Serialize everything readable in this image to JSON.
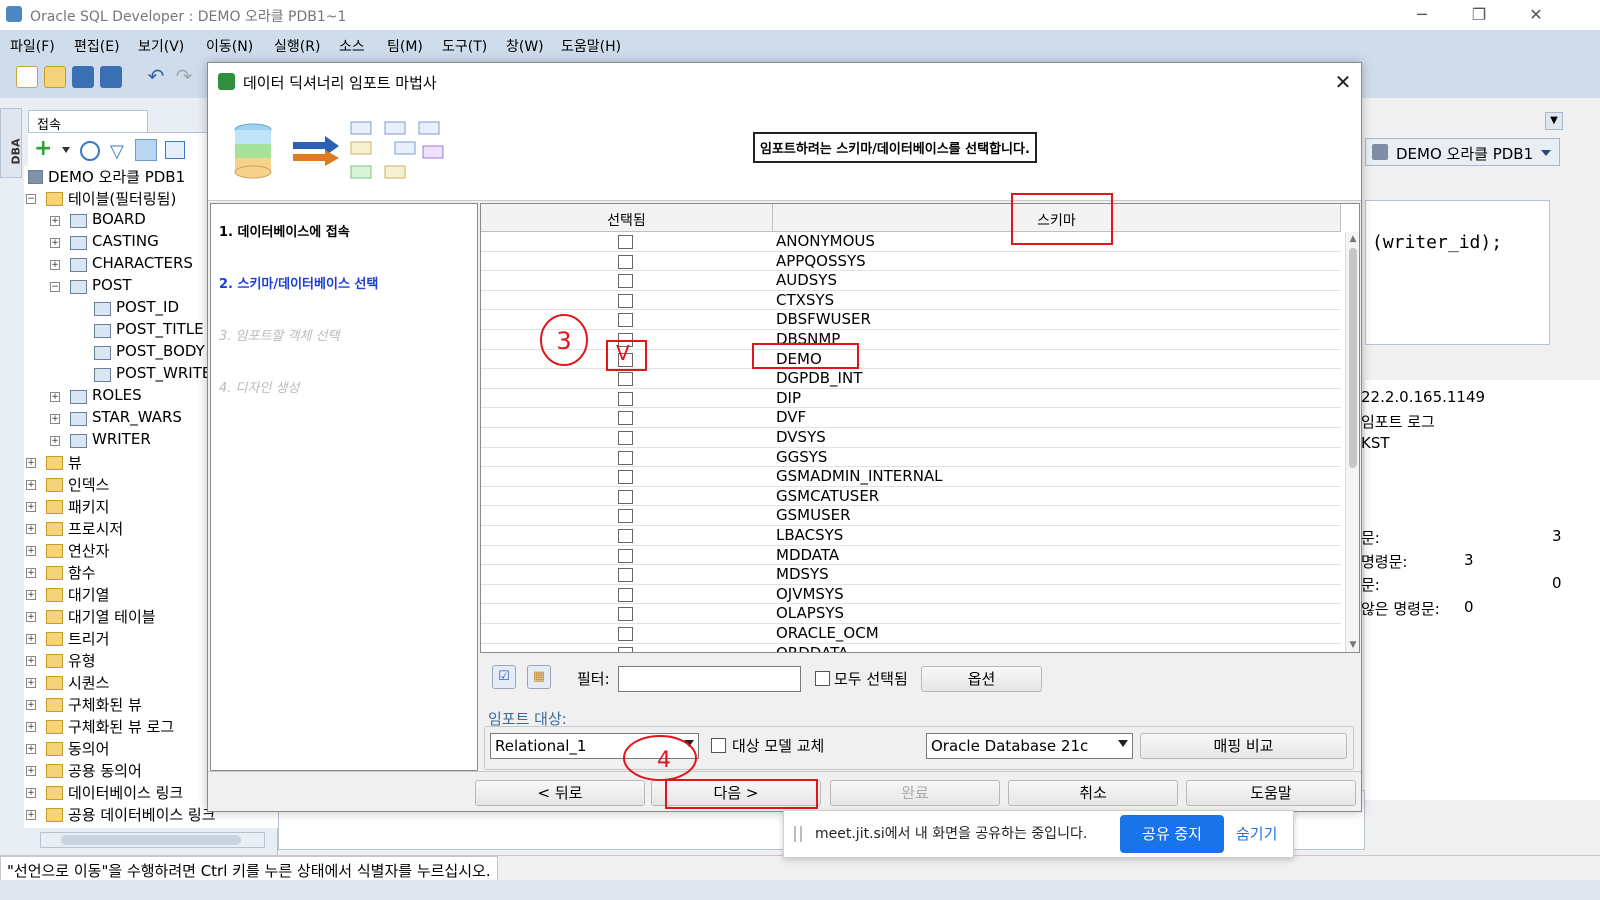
{
  "window": {
    "title": "Oracle SQL Developer : DEMO 오라클 PDB1~1",
    "controls": [
      "─",
      "❐",
      "✕"
    ]
  },
  "menubar": [
    "파일(F)",
    "편집(E)",
    "보기(V)",
    "이동(N)",
    "실행(R)",
    "소스",
    "팀(M)",
    "도구(T)",
    "창(W)",
    "도움말(H)"
  ],
  "left_panel": {
    "dba_tab": "DBA",
    "connections_tab": "접속",
    "tree": [
      {
        "label": "DEMO 오라클 PDB1",
        "level": 0,
        "exp": "",
        "icon": "db"
      },
      {
        "label": "테이블(필터링됨)",
        "level": 1,
        "exp": "−",
        "icon": "folder"
      },
      {
        "label": "BOARD",
        "level": 2,
        "exp": "+",
        "icon": "table"
      },
      {
        "label": "CASTING",
        "level": 2,
        "exp": "+",
        "icon": "table"
      },
      {
        "label": "CHARACTERS",
        "level": 2,
        "exp": "+",
        "icon": "table"
      },
      {
        "label": "POST",
        "level": 2,
        "exp": "−",
        "icon": "table"
      },
      {
        "label": "POST_ID",
        "level": 3,
        "exp": "",
        "icon": "column"
      },
      {
        "label": "POST_TITLE",
        "level": 3,
        "exp": "",
        "icon": "column"
      },
      {
        "label": "POST_BODY",
        "level": 3,
        "exp": "",
        "icon": "column"
      },
      {
        "label": "POST_WRITE",
        "level": 3,
        "exp": "",
        "icon": "column"
      },
      {
        "label": "ROLES",
        "level": 2,
        "exp": "+",
        "icon": "table"
      },
      {
        "label": "STAR_WARS",
        "level": 2,
        "exp": "+",
        "icon": "table"
      },
      {
        "label": "WRITER",
        "level": 2,
        "exp": "+",
        "icon": "table"
      },
      {
        "label": "뷰",
        "level": 1,
        "exp": "+",
        "icon": "folder"
      },
      {
        "label": "인덱스",
        "level": 1,
        "exp": "+",
        "icon": "folder"
      },
      {
        "label": "패키지",
        "level": 1,
        "exp": "+",
        "icon": "folder"
      },
      {
        "label": "프로시저",
        "level": 1,
        "exp": "+",
        "icon": "folder"
      },
      {
        "label": "연산자",
        "level": 1,
        "exp": "+",
        "icon": "folder"
      },
      {
        "label": "함수",
        "level": 1,
        "exp": "+",
        "icon": "folder"
      },
      {
        "label": "대기열",
        "level": 1,
        "exp": "+",
        "icon": "folder"
      },
      {
        "label": "대기열 테이블",
        "level": 1,
        "exp": "+",
        "icon": "folder"
      },
      {
        "label": "트리거",
        "level": 1,
        "exp": "+",
        "icon": "folder"
      },
      {
        "label": "유형",
        "level": 1,
        "exp": "+",
        "icon": "folder"
      },
      {
        "label": "시퀀스",
        "level": 1,
        "exp": "+",
        "icon": "folder"
      },
      {
        "label": "구체화된 뷰",
        "level": 1,
        "exp": "+",
        "icon": "folder"
      },
      {
        "label": "구체화된 뷰 로그",
        "level": 1,
        "exp": "+",
        "icon": "folder"
      },
      {
        "label": "동의어",
        "level": 1,
        "exp": "+",
        "icon": "folder"
      },
      {
        "label": "공용 동의어",
        "level": 1,
        "exp": "+",
        "icon": "folder"
      },
      {
        "label": "데이터베이스 링크",
        "level": 1,
        "exp": "+",
        "icon": "folder"
      },
      {
        "label": "공용 데이터베이스 링크",
        "level": 1,
        "exp": "+",
        "icon": "folder"
      }
    ]
  },
  "right_panel": {
    "connection_combo": "DEMO 오라클 PDB1",
    "editor_text": "(writer_id);",
    "log": [
      {
        "label": "22.2.0.165.1149",
        "value": ""
      },
      {
        "label": "임포트 로그",
        "value": ""
      },
      {
        "label": "KST",
        "value": ""
      },
      {
        "label": "문:",
        "value": "3"
      },
      {
        "label": "명령문:",
        "value": "3"
      },
      {
        "label": "문:",
        "value": "0"
      },
      {
        "label": "않은 명령문:",
        "value": "0"
      }
    ]
  },
  "dialog": {
    "title": "데이터 딕셔너리 임포트 마법사",
    "close": "✕",
    "header_message": "임포트하려는 스키마/데이터베이스를 선택합니다.",
    "steps": [
      {
        "label": "1. 데이터베이스에 접속",
        "state": "done"
      },
      {
        "label": "2. 스키마/데이터베이스 선택",
        "state": "active"
      },
      {
        "label": "3. 임포트할 객체 선택",
        "state": "disabled"
      },
      {
        "label": "4. 디자인 생성",
        "state": "disabled"
      }
    ],
    "grid": {
      "col_selected": "선택됨",
      "col_schema": "스키마",
      "rows": [
        {
          "name": "ANONYMOUS",
          "checked": false
        },
        {
          "name": "APPQOSSYS",
          "checked": false
        },
        {
          "name": "AUDSYS",
          "checked": false
        },
        {
          "name": "CTXSYS",
          "checked": false
        },
        {
          "name": "DBSFWUSER",
          "checked": false
        },
        {
          "name": "DBSNMP",
          "checked": false
        },
        {
          "name": "DEMO",
          "checked": true
        },
        {
          "name": "DGPDB_INT",
          "checked": false
        },
        {
          "name": "DIP",
          "checked": false
        },
        {
          "name": "DVF",
          "checked": false
        },
        {
          "name": "DVSYS",
          "checked": false
        },
        {
          "name": "GGSYS",
          "checked": false
        },
        {
          "name": "GSMADMIN_INTERNAL",
          "checked": false
        },
        {
          "name": "GSMCATUSER",
          "checked": false
        },
        {
          "name": "GSMUSER",
          "checked": false
        },
        {
          "name": "LBACSYS",
          "checked": false
        },
        {
          "name": "MDDATA",
          "checked": false
        },
        {
          "name": "MDSYS",
          "checked": false
        },
        {
          "name": "OJVMSYS",
          "checked": false
        },
        {
          "name": "OLAPSYS",
          "checked": false
        },
        {
          "name": "ORACLE_OCM",
          "checked": false
        },
        {
          "name": "ORDDATA",
          "checked": false
        }
      ]
    },
    "filter_label": "필터:",
    "filter_value": "",
    "select_all_label": "모두 선택됨",
    "options_button": "옵션",
    "import_target_label": "임포트 대상:",
    "model_combo": "Relational_1",
    "replace_model_label": "대상 모델 교체",
    "db_combo": "Oracle Database 21c",
    "compare_button": "매핑 비교",
    "buttons": {
      "back": "< 뒤로",
      "next": "다음 >",
      "finish": "완료",
      "cancel": "취소",
      "help": "도움말"
    }
  },
  "annotations": {
    "circle_3": "3",
    "circle_4": "4",
    "check_mark": "V"
  },
  "screen_share": {
    "message": "meet.jit.si에서 내 화면을 공유하는 중입니다.",
    "stop_button": "공유 중지",
    "hide_link": "숨기기"
  },
  "statusbar": "\"선언으로 이동\"을 수행하려면 Ctrl 키를 누른 상태에서 식별자를 누르십시오.",
  "colors": {
    "accent": "#1a3fd9",
    "annotation": "#e4141a",
    "share_button": "#1a73e8",
    "menubar_bg": "#cfdcec"
  }
}
